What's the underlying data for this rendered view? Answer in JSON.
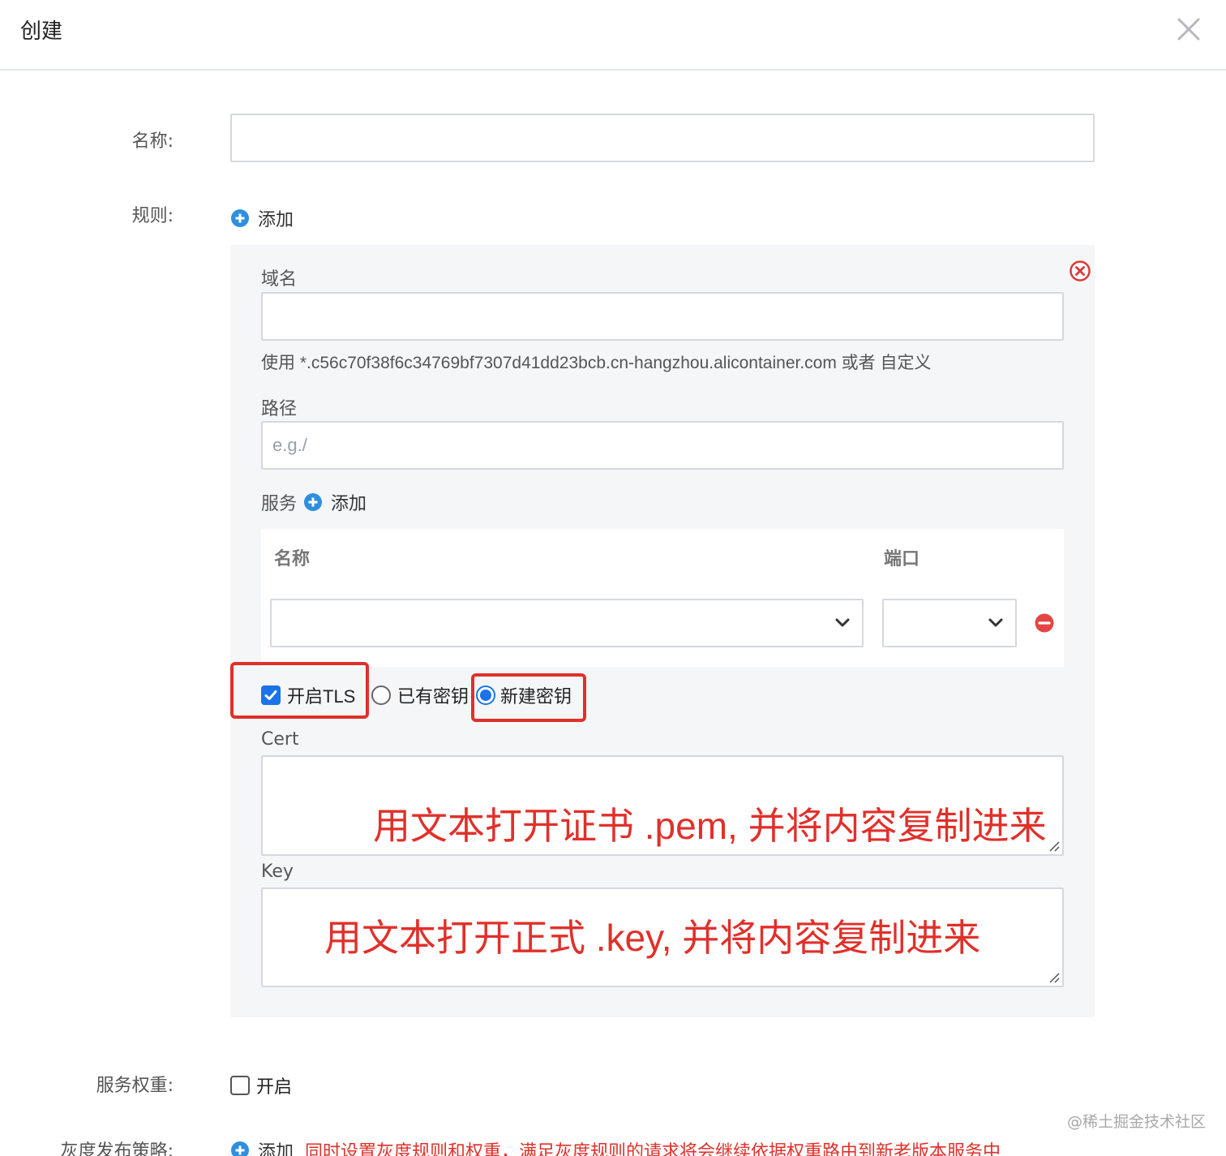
{
  "dialog": {
    "title": "创建"
  },
  "form": {
    "name_label": "名称:",
    "name_value": "",
    "rules_label": "规则:",
    "rules_add": "添加",
    "rule": {
      "domain_label": "域名",
      "domain_value": "",
      "domain_hint": "使用 *.c56c70f38f6c34769bf7307d41dd23bcb.cn-hangzhou.alicontainer.com 或者 自定义",
      "path_label": "路径",
      "path_placeholder": "e.g./",
      "service_label": "服务",
      "service_add": "添加",
      "service_table": {
        "col_name": "名称",
        "col_port": "端口",
        "row_name_value": "",
        "row_port_value": ""
      },
      "tls_label": "开启TLS",
      "tls_checked": true,
      "secret_options": [
        "已有密钥",
        "新建密钥"
      ],
      "secret_selected": "新建密钥",
      "cert_label": "Cert",
      "cert_annotation": "用文本打开证书 .pem, 并将内容复制进来",
      "key_label": "Key",
      "key_annotation": "用文本打开正式 .key, 并将内容复制进来"
    },
    "weight_label": "服务权重:",
    "weight_toggle_label": "开启",
    "weight_checked": false,
    "canary_label": "灰度发布策略:",
    "canary_add": "添加",
    "canary_note": "同时设置灰度规则和权重，满足灰度规则的请求将会继续依据权重路由到新老版本服务中"
  },
  "watermark": "@稀土掘金技术社区",
  "colors": {
    "accent": "#1a73e8",
    "add_icon": "#2d8fdd",
    "danger": "#e0302a",
    "panel_bg": "#f5f6f8"
  },
  "icons": [
    "close-icon",
    "plus-circle-icon",
    "remove-circle-icon",
    "minus-circle-icon",
    "chevron-down-icon",
    "check-icon",
    "resize-grip-icon"
  ]
}
